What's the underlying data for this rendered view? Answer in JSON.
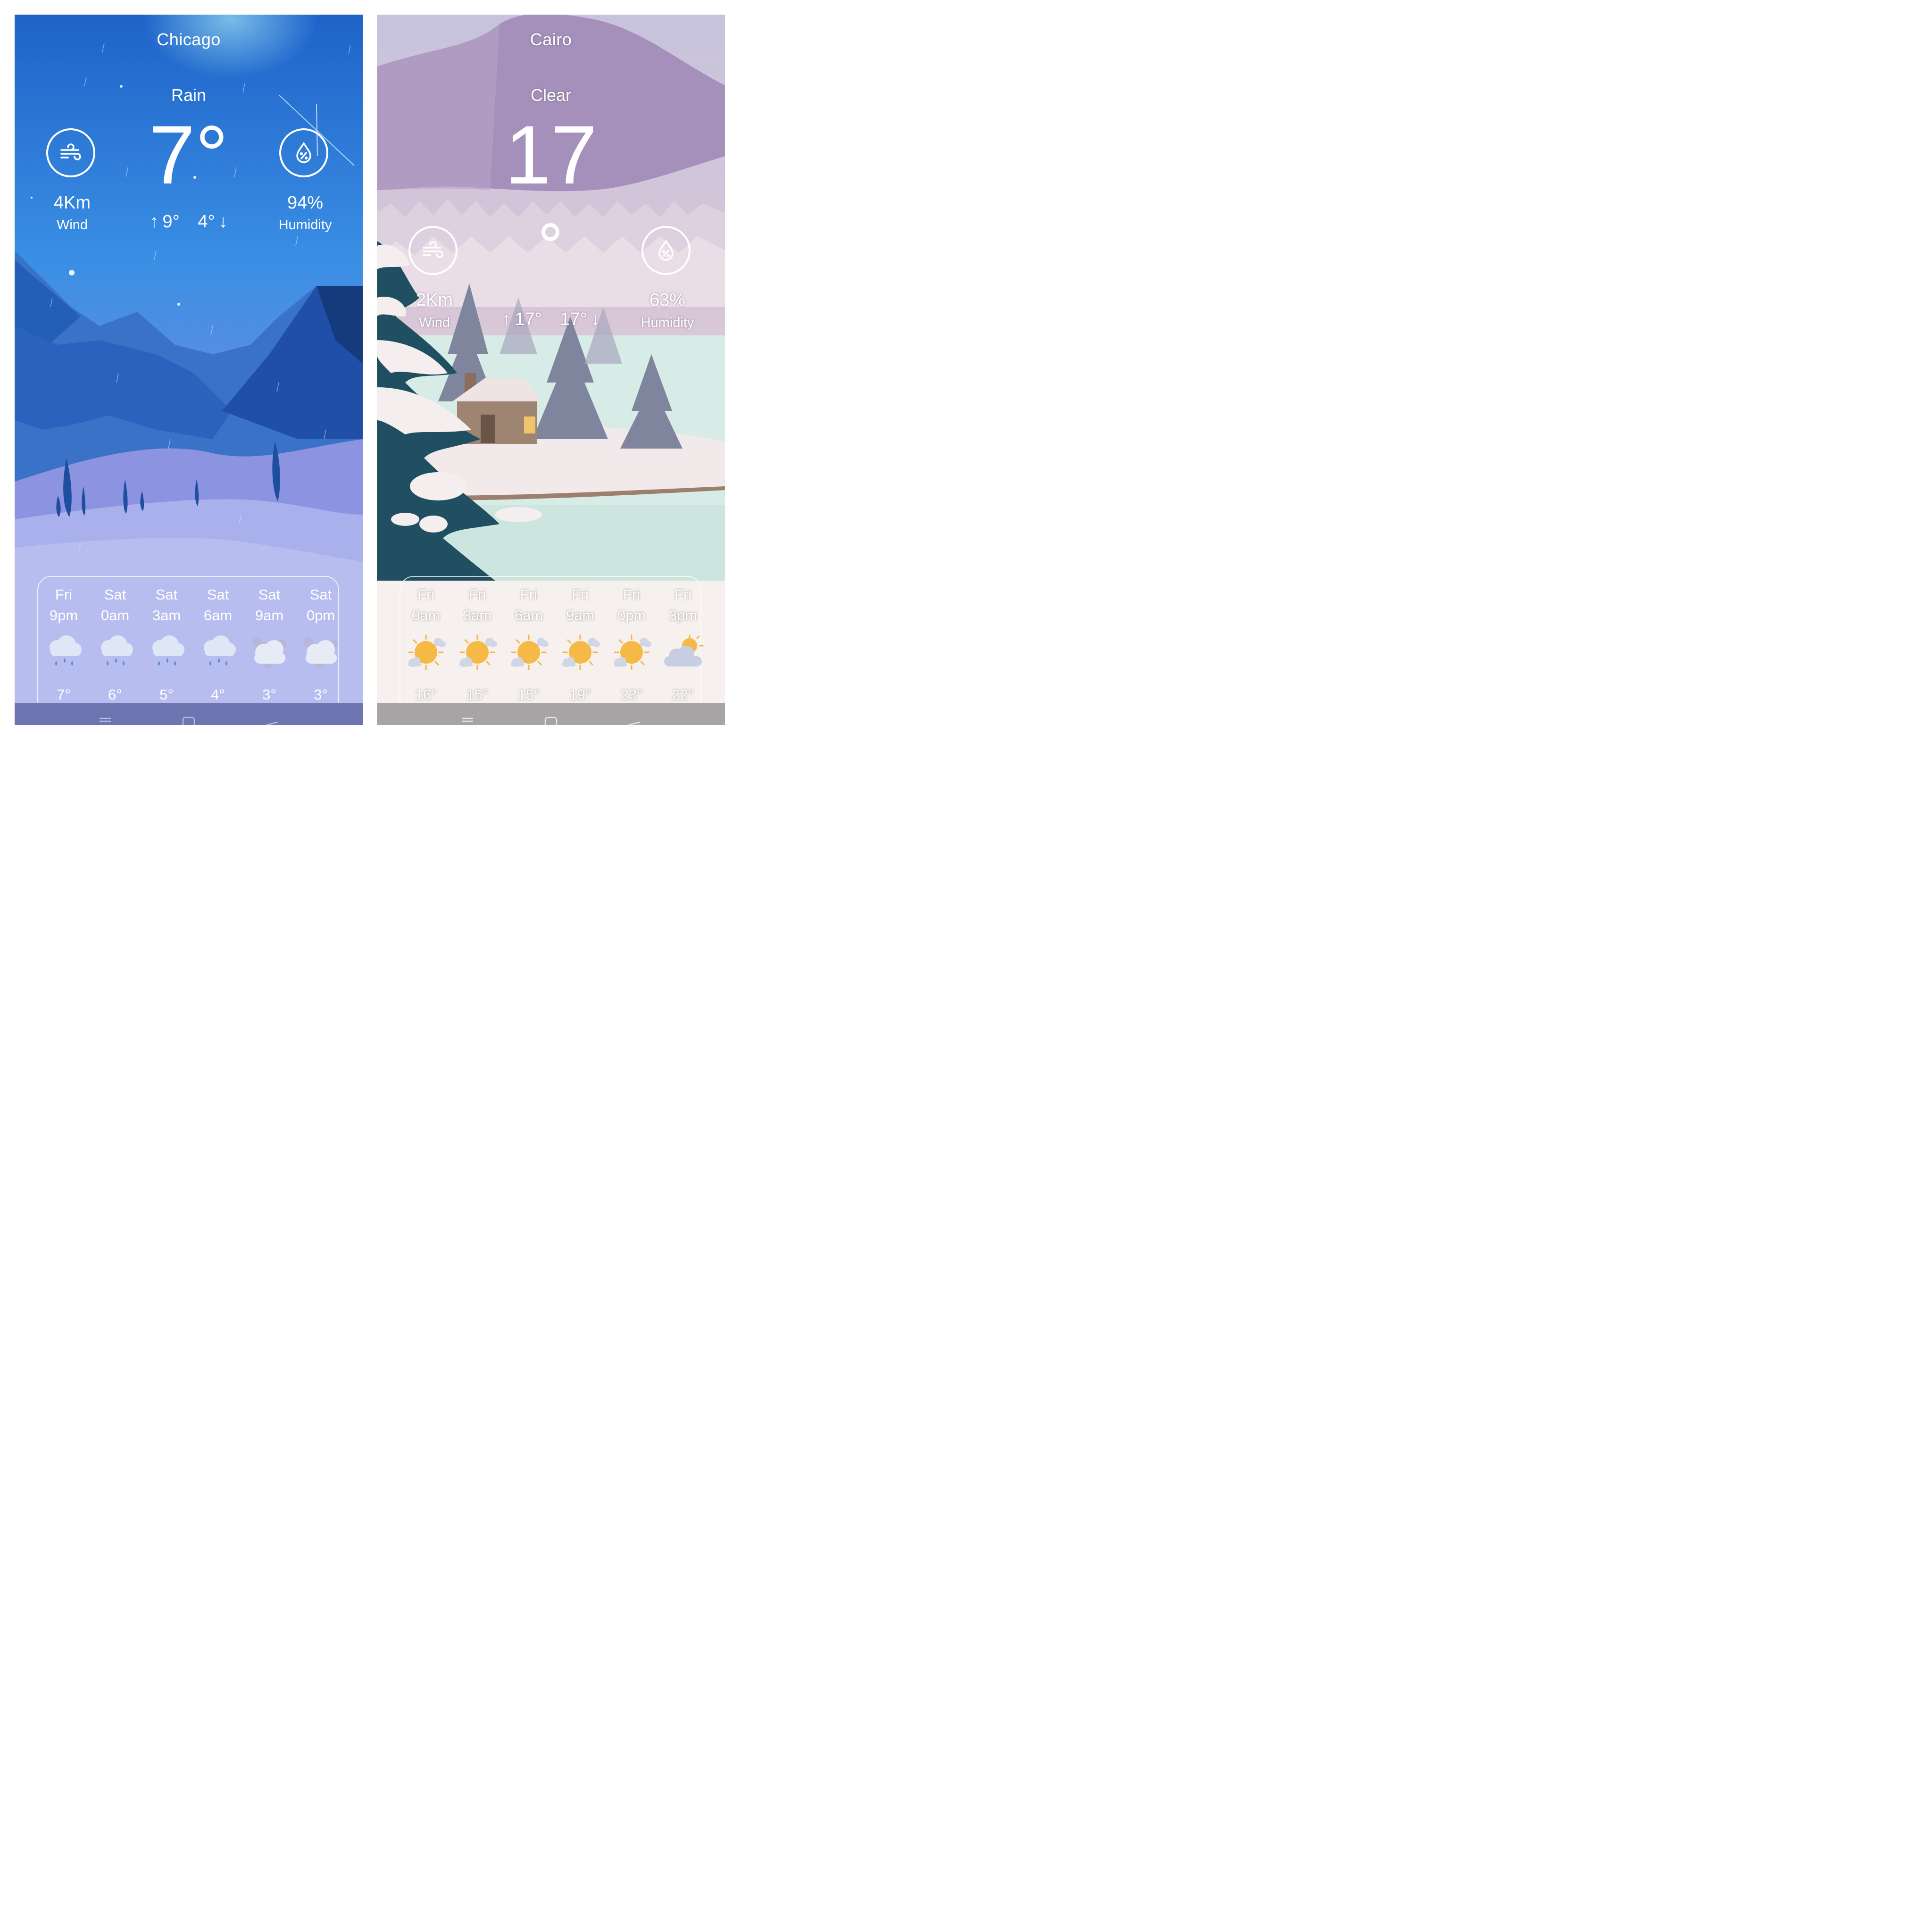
{
  "left": {
    "city": "Chicago",
    "condition": "Rain",
    "temperature": "7°",
    "high": "9°",
    "low": "4°",
    "wind": {
      "value": "4Km",
      "label": "Wind"
    },
    "humidity": {
      "value": "94%",
      "label": "Humidity"
    },
    "forecast": [
      {
        "day": "Fri",
        "time": "9pm",
        "temp": "7°",
        "icon": "rain-cloud-icon"
      },
      {
        "day": "Sat",
        "time": "0am",
        "temp": "6°",
        "icon": "rain-cloud-icon"
      },
      {
        "day": "Sat",
        "time": "3am",
        "temp": "5°",
        "icon": "rain-cloud-icon"
      },
      {
        "day": "Sat",
        "time": "6am",
        "temp": "4°",
        "icon": "rain-cloud-icon"
      },
      {
        "day": "Sat",
        "time": "9am",
        "temp": "3°",
        "icon": "cloudy-icon"
      },
      {
        "day": "Sat",
        "time": "0pm",
        "temp": "3°",
        "icon": "cloudy-icon"
      }
    ]
  },
  "right": {
    "city": "Cairo",
    "condition": "Clear",
    "temperature": "17",
    "high": "17°",
    "low": "17°",
    "wind": {
      "value": "2Km",
      "label": "Wind"
    },
    "humidity": {
      "value": "63%",
      "label": "Humidity"
    },
    "forecast": [
      {
        "day": "Fri",
        "time": "0am",
        "temp": "16°",
        "icon": "sun-cloud-icon"
      },
      {
        "day": "Fri",
        "time": "3am",
        "temp": "15°",
        "icon": "sun-cloud-icon"
      },
      {
        "day": "Fri",
        "time": "6am",
        "temp": "15°",
        "icon": "sun-cloud-icon"
      },
      {
        "day": "Fri",
        "time": "9am",
        "temp": "19°",
        "icon": "sun-cloud-icon"
      },
      {
        "day": "Fri",
        "time": "0pm",
        "temp": "23°",
        "icon": "sun-cloud-icon"
      },
      {
        "day": "Fri",
        "time": "3pm",
        "temp": "22°",
        "icon": "cloud-sun-icon"
      }
    ]
  },
  "colors": {
    "sky_blue_top": "#2f7fd6",
    "sky_blue_bottom": "#7d8fe0",
    "lavender_top": "#c9c3dc",
    "mountain_purple": "#a58fb9",
    "pine_teal": "#1f4f60"
  }
}
